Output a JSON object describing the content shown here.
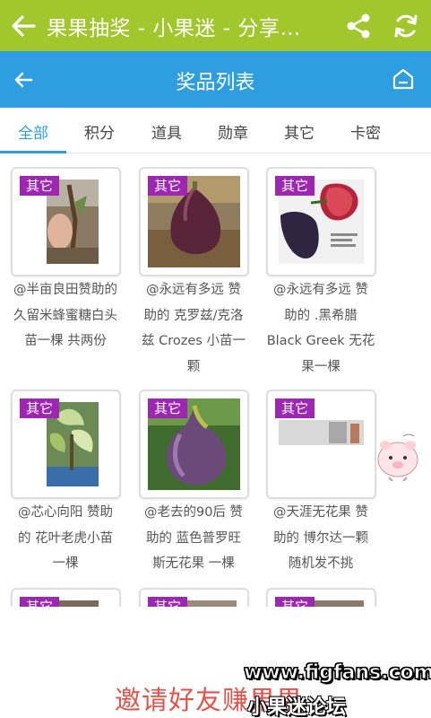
{
  "app_bar": {
    "title": "果果抽奖 - 小果迷 - 分享…",
    "background": "#a2c72c",
    "icons": [
      "back-arrow-icon",
      "share-icon",
      "refresh-icon"
    ]
  },
  "sub_bar": {
    "title": "奖品列表",
    "background": "#2e9ee0",
    "icons": [
      "back-arrow-icon",
      "home-icon"
    ]
  },
  "tabs": [
    {
      "label": "全部",
      "active": true
    },
    {
      "label": "积分",
      "active": false
    },
    {
      "label": "道具",
      "active": false
    },
    {
      "label": "勋章",
      "active": false
    },
    {
      "label": "其它",
      "active": false
    },
    {
      "label": "卡密",
      "active": false
    }
  ],
  "accent_color": "#2e9ee0",
  "badge_color": "#9c27b0",
  "prizes": [
    {
      "badge": "其它",
      "lines": [
        "@半亩良田赞助的",
        "久留米蜂蜜糖白头",
        "苗一棵 共两份"
      ]
    },
    {
      "badge": "其它",
      "lines": [
        "@永远有多远 赞",
        "助的 克罗兹/克洛",
        "兹 Crozes 小苗一",
        "颗"
      ]
    },
    {
      "badge": "其它",
      "lines": [
        "@永远有多远 赞",
        "助的 .黑希腊",
        "Black Greek 无花",
        "果一棵"
      ]
    },
    {
      "badge": "其它",
      "lines": [
        "@芯心向阳 赞助",
        "的 花叶老虎小苗",
        "一棵"
      ]
    },
    {
      "badge": "其它",
      "lines": [
        "@老去的90后 赞",
        "助的 蓝色普罗旺",
        "斯无花果 一棵"
      ]
    },
    {
      "badge": "其它",
      "lines": [
        "@天涯无花果 赞",
        "助的 博尔达一颗",
        "随机发不挑"
      ]
    },
    {
      "badge": "其它",
      "lines": []
    },
    {
      "badge": "其它",
      "lines": []
    },
    {
      "badge": "其它",
      "lines": []
    }
  ],
  "footer": {
    "invite_text": "邀请好友赚果果"
  },
  "watermark": {
    "url": "www.figfans.com",
    "forum": "小果迷论坛"
  }
}
